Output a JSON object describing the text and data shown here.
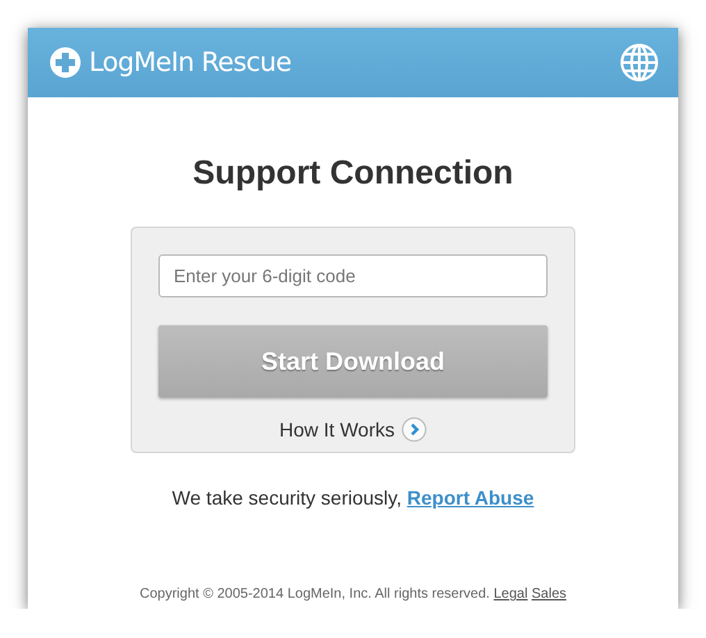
{
  "header": {
    "title": "LogMeIn Rescue"
  },
  "heading": "Support Connection",
  "code_field": {
    "placeholder": "Enter your 6-digit code"
  },
  "start_button": {
    "label": "Start Download",
    "disabled": true
  },
  "how_it_works": {
    "label": "How It Works"
  },
  "security": {
    "text": "We take security seriously,",
    "link": "Report Abuse"
  },
  "footer": {
    "copyright": "Copyright © 2005-2014 LogMeIn, Inc. All rights reserved.",
    "links": [
      "Legal",
      "Sales"
    ]
  }
}
